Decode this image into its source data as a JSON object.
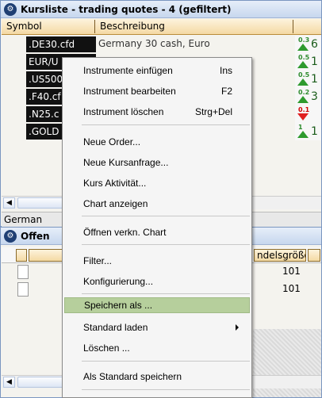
{
  "top_window": {
    "icon": "gear-badge-icon",
    "title": "Kursliste - trading quotes - 4 (gefiltert)",
    "columns": [
      "Symbol",
      "Beschreibung"
    ],
    "rows": [
      {
        "symbol": ".DE30.cfd",
        "description": "Germany 30 cash, Euro",
        "spread": "0.3",
        "direction": "up",
        "digit": "6"
      },
      {
        "symbol": "EUR/U",
        "description": "",
        "spread": "0.5",
        "direction": "up",
        "digit": "1"
      },
      {
        "symbol": ".US500",
        "description": "",
        "spread": "0.5",
        "direction": "up",
        "digit": "1"
      },
      {
        "symbol": ".F40.cf",
        "description": "",
        "spread": "0.2",
        "direction": "up",
        "digit": "3"
      },
      {
        "symbol": ".N25.c",
        "description": "",
        "spread": "0.1",
        "direction": "down",
        "digit": ""
      },
      {
        "symbol": ".GOLD",
        "description": "",
        "spread": "1",
        "direction": "up",
        "digit": "1"
      }
    ],
    "status_text": "German"
  },
  "bottom_window": {
    "icon": "gear-badge-icon",
    "title": "Offen",
    "column_partial": "ndelsgröße",
    "rows": [
      {
        "value": "101"
      },
      {
        "value": "101"
      }
    ]
  },
  "context_menu": {
    "items": [
      {
        "label": "Instrumente einfügen",
        "shortcut": "Ins"
      },
      {
        "label": "Instrument bearbeiten",
        "shortcut": "F2"
      },
      {
        "label": "Instrument löschen",
        "shortcut": "Strg+Del"
      },
      {
        "label": "Neue Order..."
      },
      {
        "label": "Neue Kursanfrage..."
      },
      {
        "label": "Kurs Aktivität..."
      },
      {
        "label": "Chart anzeigen"
      },
      {
        "label": "Öffnen verkn. Chart"
      },
      {
        "label": "Filter..."
      },
      {
        "label": "Konfigurierung..."
      },
      {
        "label": "Speichern als ..."
      },
      {
        "label": "Standard laden"
      },
      {
        "label": "Löschen ..."
      },
      {
        "label": "Als Standard speichern"
      }
    ],
    "highlighted_index": 10,
    "highlight_color": "#b6cf9c"
  }
}
